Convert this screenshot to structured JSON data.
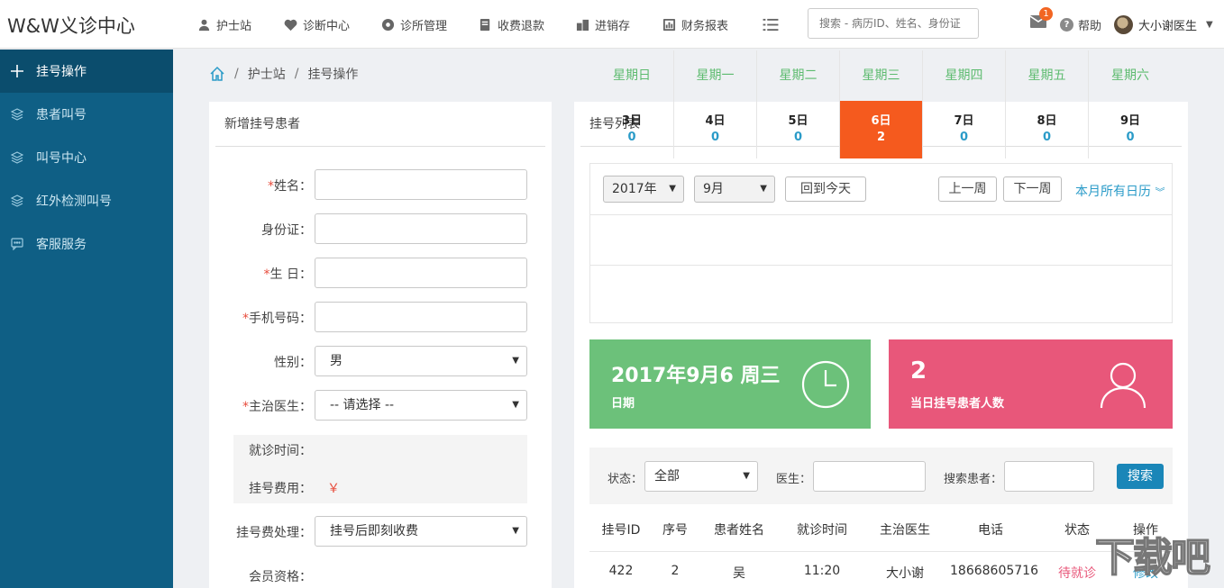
{
  "app": {
    "logo": "W&W义诊中心"
  },
  "nav": [
    {
      "label": "护士站",
      "icon": "nurse-icon"
    },
    {
      "label": "诊断中心",
      "icon": "heart-pulse-icon"
    },
    {
      "label": "诊所管理",
      "icon": "gear-icon"
    },
    {
      "label": "收费退款",
      "icon": "receipt-icon"
    },
    {
      "label": "进销存",
      "icon": "inventory-icon"
    },
    {
      "label": "财务报表",
      "icon": "report-icon"
    }
  ],
  "header": {
    "search_placeholder": "搜索 - 病历ID、姓名、身份证",
    "mail_badge": "1",
    "help_label": "帮助",
    "user_name": "大小谢医生"
  },
  "sidebar": {
    "items": [
      {
        "label": "挂号操作",
        "icon": "plus-icon",
        "active": true
      },
      {
        "label": "患者叫号",
        "icon": "layers-icon"
      },
      {
        "label": "叫号中心",
        "icon": "layers-icon"
      },
      {
        "label": "红外检测叫号",
        "icon": "layers-icon"
      },
      {
        "label": "客服服务",
        "icon": "chat-icon"
      }
    ]
  },
  "breadcrumb": {
    "items": [
      "护士站",
      "挂号操作"
    ]
  },
  "form": {
    "title": "新增挂号患者",
    "name_label": "姓名：",
    "id_label": "身份证：",
    "birthday_label": "生 日：",
    "phone_label": "手机号码：",
    "gender_label": "性别：",
    "gender_value": "男",
    "doctor_label": "主治医生：",
    "doctor_value": "-- 请选择 --",
    "visit_time_label": "就诊时间：",
    "fee_label": "挂号费用：",
    "fee_symbol": "￥",
    "fee_handling_label": "挂号费处理：",
    "fee_handling_value": "挂号后即刻收费",
    "membership_label": "会员资格：",
    "required_mark": "*"
  },
  "list": {
    "title": "挂号列表",
    "year_value": "2017年",
    "month_value": "9月",
    "today_btn": "回到今天",
    "prev_week_btn": "上一周",
    "next_week_btn": "下一周",
    "month_all_link": "本月所有日历",
    "weekdays": [
      "星期日",
      "星期一",
      "星期二",
      "星期三",
      "星期四",
      "星期五",
      "星期六"
    ],
    "days": [
      {
        "day": "3日",
        "count": "0"
      },
      {
        "day": "4日",
        "count": "0"
      },
      {
        "day": "5日",
        "count": "0"
      },
      {
        "day": "6日",
        "count": "2",
        "today": true
      },
      {
        "day": "7日",
        "count": "0"
      },
      {
        "day": "8日",
        "count": "0"
      },
      {
        "day": "9日",
        "count": "0"
      }
    ],
    "date_card": {
      "value": "2017年9月6 周三",
      "label": "日期",
      "color": "#6cc17a"
    },
    "count_card": {
      "value": "2",
      "label": "当日挂号患者人数",
      "color": "#e8577a"
    },
    "filter": {
      "status_label": "状态：",
      "status_value": "全部",
      "doctor_label": "医生：",
      "patient_label": "搜索患者：",
      "search_btn": "搜索"
    },
    "table": {
      "headers": [
        "挂号ID",
        "序号",
        "患者姓名",
        "就诊时间",
        "主治医生",
        "电话",
        "状态",
        "操作"
      ],
      "rows": [
        {
          "id": "422",
          "seq": "2",
          "name": "吴",
          "time": "11:20",
          "doctor": "大小谢",
          "phone": "18668605716",
          "status": "待就诊",
          "action": "修改"
        }
      ]
    }
  },
  "watermark": "下载吧"
}
